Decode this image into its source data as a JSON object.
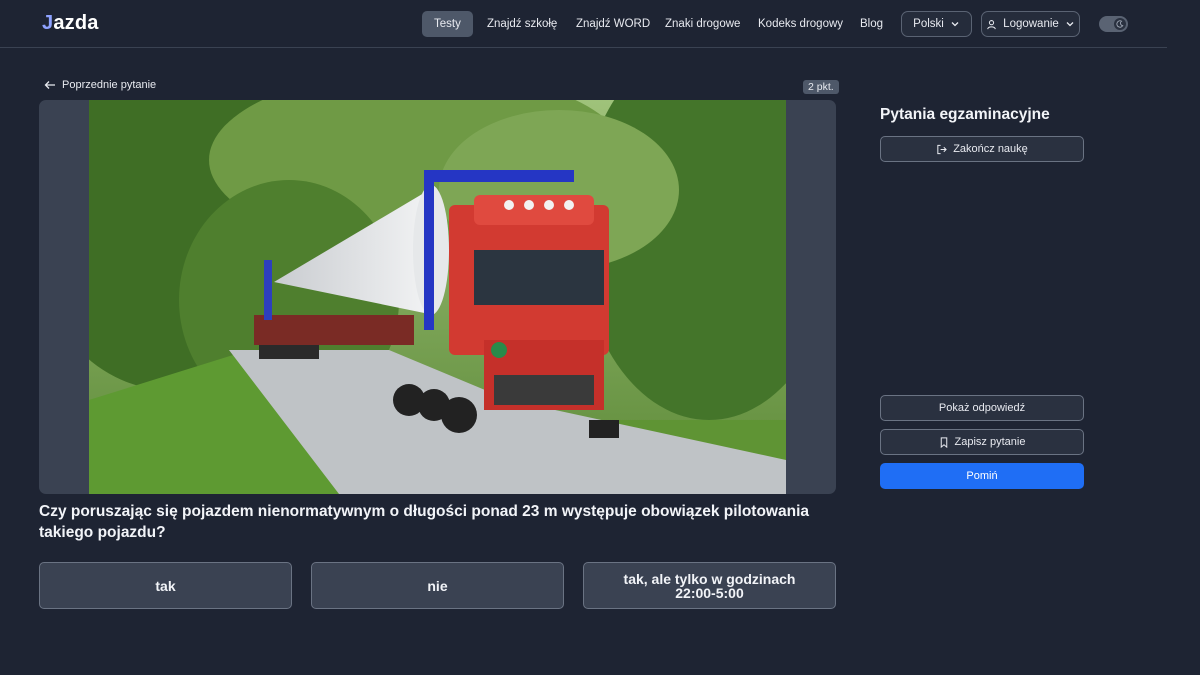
{
  "header": {
    "logo_text": "azda",
    "logo_initial": "J",
    "nav": [
      "Testy",
      "Znajdź szkołę",
      "Znajdź WORD",
      "Znaki drogowe",
      "Kodeks drogowy",
      "Blog"
    ],
    "language": "Polski",
    "login": "Logowanie"
  },
  "question_view": {
    "prev_label": "Poprzednie pytanie",
    "points": "2 pkt.",
    "question_text": "Czy poruszając się pojazdem nienormatywnym o długości ponad 23 m występuje obowiązek pilotowania takiego pojazdu?",
    "answers": [
      "tak",
      "nie",
      "tak, ale tylko w godzinach 22:00-5:00"
    ]
  },
  "sidebar": {
    "title": "Pytania egzaminacyjne",
    "end_button": "Zakończ naukę",
    "show_answer_button": "Pokaż odpowiedź",
    "save_button": "Zapisz pytanie",
    "skip_button": "Pomiń"
  },
  "colors": {
    "background": "#1e2433",
    "card": "#3a4252",
    "accent": "#1f6ef5"
  },
  "icons": [
    "arrow-left-icon",
    "chevron-down-icon",
    "user-icon",
    "moon-icon",
    "logout-icon",
    "bookmark-icon"
  ]
}
